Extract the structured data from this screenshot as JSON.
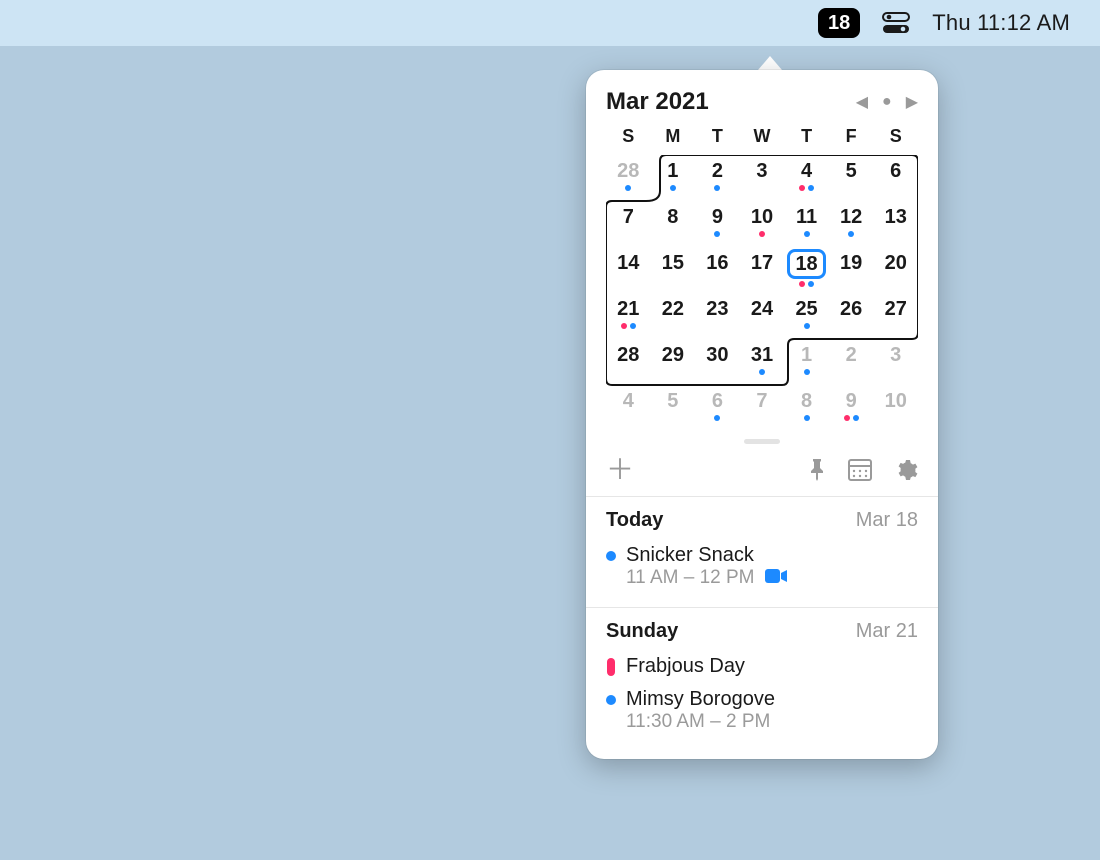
{
  "menubar": {
    "date_badge": "18",
    "clock": "Thu 11:12 AM"
  },
  "calendar": {
    "month_label": "Mar 2021",
    "dow": [
      "S",
      "M",
      "T",
      "W",
      "T",
      "F",
      "S"
    ],
    "days": [
      {
        "n": "28",
        "out": true,
        "dots": [
          "b"
        ]
      },
      {
        "n": "1",
        "dots": [
          "b"
        ]
      },
      {
        "n": "2",
        "dots": [
          "b"
        ]
      },
      {
        "n": "3"
      },
      {
        "n": "4",
        "dots": [
          "r",
          "b"
        ]
      },
      {
        "n": "5"
      },
      {
        "n": "6"
      },
      {
        "n": "7"
      },
      {
        "n": "8"
      },
      {
        "n": "9",
        "dots": [
          "b"
        ]
      },
      {
        "n": "10",
        "dots": [
          "r"
        ]
      },
      {
        "n": "11",
        "dots": [
          "b"
        ]
      },
      {
        "n": "12",
        "dots": [
          "b"
        ]
      },
      {
        "n": "13"
      },
      {
        "n": "14"
      },
      {
        "n": "15"
      },
      {
        "n": "16"
      },
      {
        "n": "17"
      },
      {
        "n": "18",
        "today": true,
        "dots": [
          "r",
          "b"
        ]
      },
      {
        "n": "19"
      },
      {
        "n": "20"
      },
      {
        "n": "21",
        "dots": [
          "r",
          "b"
        ]
      },
      {
        "n": "22"
      },
      {
        "n": "23"
      },
      {
        "n": "24"
      },
      {
        "n": "25",
        "dots": [
          "b"
        ]
      },
      {
        "n": "26"
      },
      {
        "n": "27"
      },
      {
        "n": "28"
      },
      {
        "n": "29"
      },
      {
        "n": "30"
      },
      {
        "n": "31",
        "dots": [
          "b"
        ]
      },
      {
        "n": "1",
        "out": true,
        "dots": [
          "b"
        ]
      },
      {
        "n": "2",
        "out": true
      },
      {
        "n": "3",
        "out": true
      },
      {
        "n": "4",
        "out": true
      },
      {
        "n": "5",
        "out": true
      },
      {
        "n": "6",
        "out": true,
        "dots": [
          "b"
        ]
      },
      {
        "n": "7",
        "out": true
      },
      {
        "n": "8",
        "out": true,
        "dots": [
          "b"
        ]
      },
      {
        "n": "9",
        "out": true,
        "dots": [
          "r",
          "b"
        ]
      },
      {
        "n": "10",
        "out": true
      }
    ]
  },
  "agenda": [
    {
      "title": "Today",
      "subtitle": "Mar 18",
      "events": [
        {
          "marker": "dot-b",
          "name": "Snicker Snack",
          "time": "11 AM – 12 PM",
          "video": true
        }
      ]
    },
    {
      "title": "Sunday",
      "subtitle": "Mar 21",
      "events": [
        {
          "marker": "pill-r",
          "name": "Frabjous Day"
        },
        {
          "marker": "dot-b",
          "name": "Mimsy Borogove",
          "time": "11:30 AM – 2 PM"
        }
      ]
    }
  ]
}
